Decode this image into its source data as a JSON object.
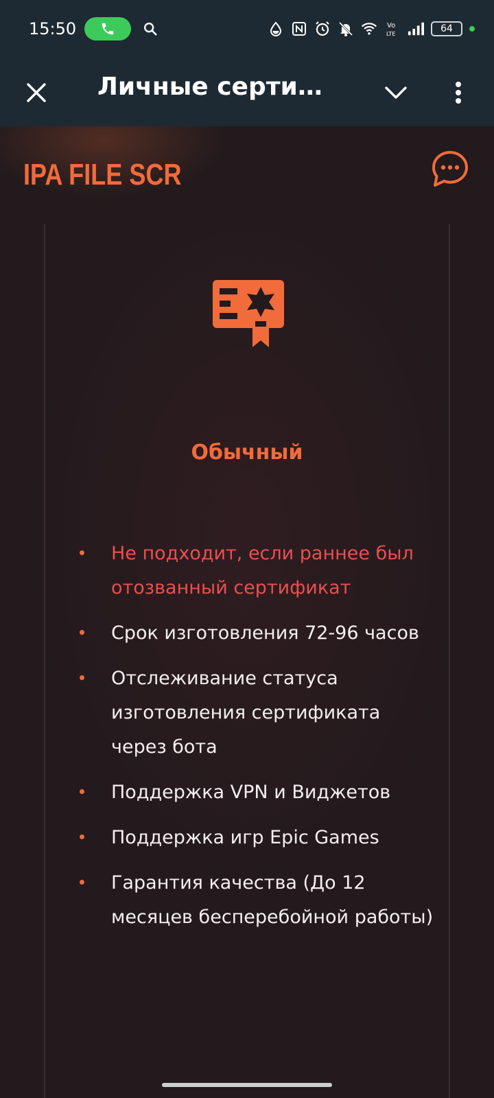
{
  "status_bar": {
    "time": "15:50",
    "battery": "64",
    "icons": [
      "phone-icon",
      "search-icon",
      "water-drop-icon",
      "nfc-icon",
      "alarm-icon",
      "mute-icon",
      "wifi-icon",
      "volte-icon",
      "signal-icon",
      "battery-icon"
    ],
    "call_color": "#3ccb5a"
  },
  "app_bar": {
    "title": "Личные сертифи...",
    "close_icon": "close-icon",
    "dropdown_icon": "chevron-down-icon",
    "more_icon": "more-vert-icon"
  },
  "site": {
    "brand": "IPA FILE SCR",
    "chat_icon": "chat-bubble-icon",
    "accent": "#f26b3a"
  },
  "plan": {
    "icon": "certificate-icon",
    "name": "Обычный",
    "features": [
      {
        "text": "Не подходит, если раннее был отозванный сертификат",
        "warning": true
      },
      {
        "text": "Срок изготовления 72-96 часов",
        "warning": false
      },
      {
        "text": "Отслеживание статуса изготовления сертификата через бота",
        "warning": false
      },
      {
        "text": "Поддержка VPN и Виджетов",
        "warning": false
      },
      {
        "text": "Поддержка игр Epic Games",
        "warning": false
      },
      {
        "text": "Гарантия качества (До 12 месяцев бесперебойной работы)",
        "warning": false
      }
    ],
    "warning_color": "#e8504f"
  }
}
